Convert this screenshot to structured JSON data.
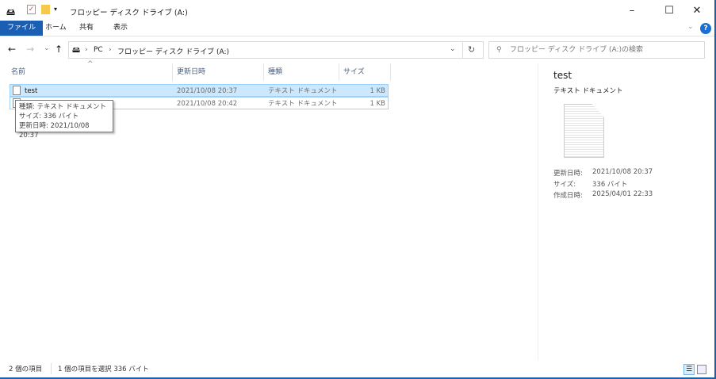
{
  "window": {
    "title": "フロッピー ディスク ドライブ (A:)",
    "minimize": "–",
    "maximize": "☐",
    "close": "✕"
  },
  "ribbon": {
    "tabs": [
      "ファイル",
      "ホーム",
      "共有",
      "表示"
    ],
    "expand": "⌄",
    "help": "?"
  },
  "nav": {
    "back": "←",
    "forward": "→",
    "recent": "⌄",
    "up": "↑",
    "breadcrumb": [
      "PC",
      "フロッピー ディスク ドライブ (A:)"
    ],
    "sep": "›",
    "dropdown": "⌄",
    "refresh": "↻"
  },
  "search": {
    "placeholder": "フロッピー ディスク ドライブ (A:)の検索"
  },
  "columns": {
    "name": "名前",
    "modified": "更新日時",
    "type": "種類",
    "size": "サイズ",
    "sort": "^"
  },
  "files": [
    {
      "name": "test",
      "modified": "2021/10/08 20:37",
      "type": "テキスト ドキュメント",
      "size": "1 KB"
    },
    {
      "name": "",
      "modified": "2021/10/08 20:42",
      "type": "テキスト ドキュメント",
      "size": "1 KB"
    }
  ],
  "tooltip": {
    "line1": "種類: テキスト ドキュメント",
    "line2": "サイズ: 336 バイト",
    "line3": "更新日時: 2021/10/08 20:37"
  },
  "preview": {
    "name": "test",
    "type": "テキスト ドキュメント",
    "modified_label": "更新日時:",
    "modified": "2021/10/08 20:37",
    "size_label": "サイズ:",
    "size": "336 バイト",
    "created_label": "作成日時:",
    "created": "2025/04/01 22:33"
  },
  "status": {
    "count": "2 個の項目",
    "selected": "1 個の項目を選択  336 バイト"
  }
}
